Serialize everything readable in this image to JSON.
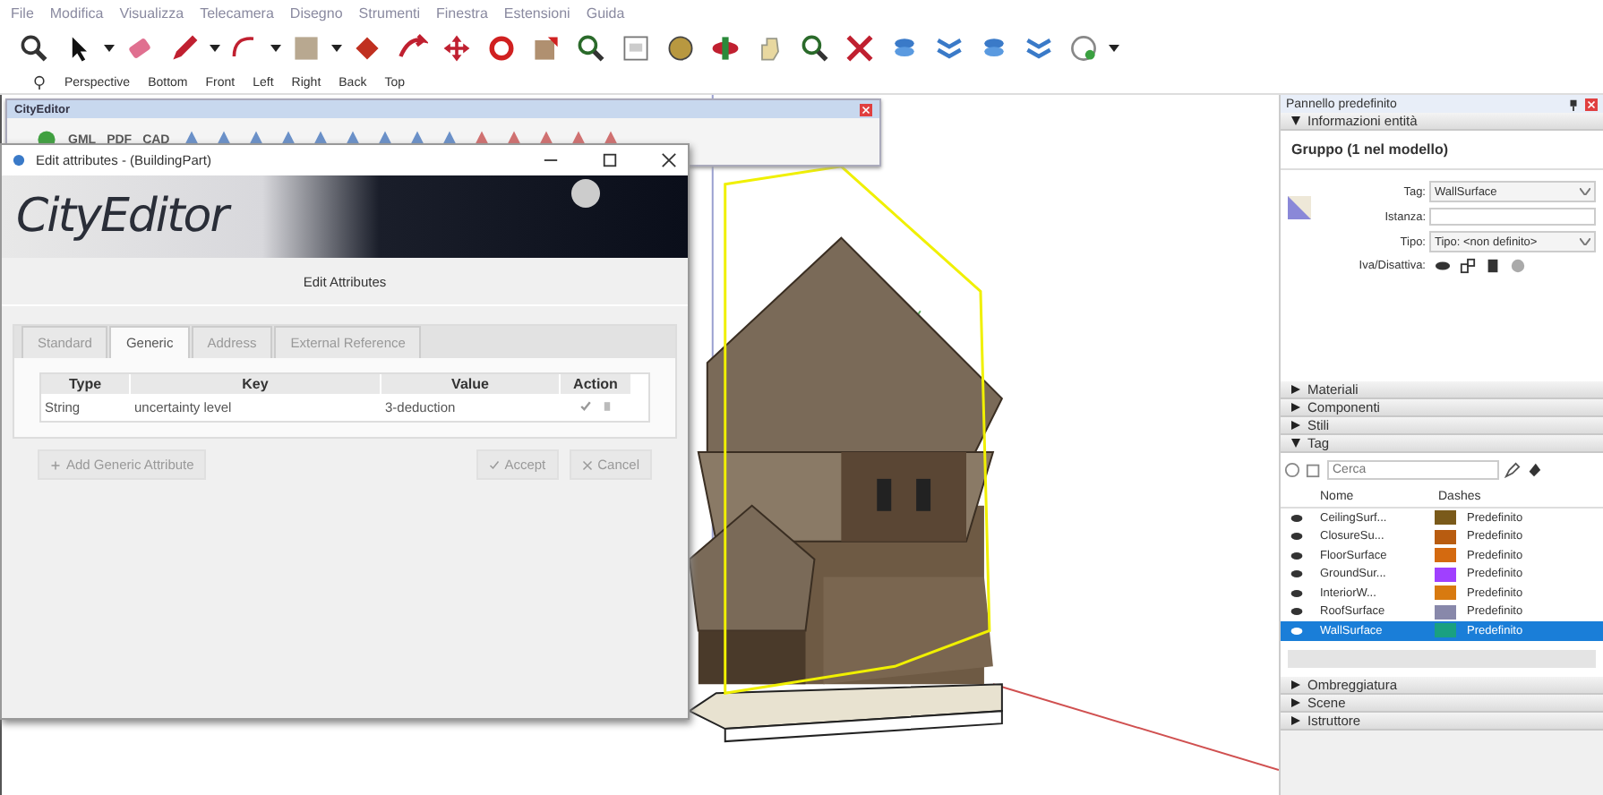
{
  "menu": [
    "File",
    "Modifica",
    "Visualizza",
    "Telecamera",
    "Disegno",
    "Strumenti",
    "Finestra",
    "Estensioni",
    "Guida"
  ],
  "views": [
    "Perspective",
    "Bottom",
    "Front",
    "Left",
    "Right",
    "Back",
    "Top"
  ],
  "cityeditor_toolbar": {
    "title": "CityEditor",
    "buttons": [
      "GML",
      "PDF",
      "CAD"
    ]
  },
  "dialog": {
    "title": "Edit attributes - (BuildingPart)",
    "logo": "CityEditor",
    "heading": "Edit Attributes",
    "tabs": [
      {
        "label": "Standard",
        "selected": false
      },
      {
        "label": "Generic",
        "selected": true
      },
      {
        "label": "Address",
        "selected": false
      },
      {
        "label": "External Reference",
        "selected": false
      }
    ],
    "table": {
      "columns": [
        "Type",
        "Key",
        "Value",
        "Action"
      ],
      "rows": [
        {
          "type": "String",
          "key": "uncertainty level",
          "value": "3-deduction"
        }
      ]
    },
    "add_button": "Add Generic Attribute",
    "accept_button": "Accept",
    "cancel_button": "Cancel"
  },
  "panel": {
    "title": "Pannello predefinito",
    "entity_info": {
      "header": "Informazioni entità",
      "expanded": true,
      "name": "Gruppo (1 nel modello)",
      "fields": [
        {
          "label": "Tag:",
          "kind": "dropdown",
          "value": "WallSurface"
        },
        {
          "label": "Istanza:",
          "kind": "input"
        },
        {
          "label": "Tipo:",
          "kind": "dropdown",
          "value": "Tipo: <non definito>"
        }
      ],
      "toggles_label": "Iva/Disattiva:"
    },
    "sections": [
      {
        "label": "Materiali",
        "expanded": false
      },
      {
        "label": "Componenti",
        "expanded": false
      },
      {
        "label": "Stili",
        "expanded": false
      },
      {
        "label": "Tag",
        "expanded": true
      }
    ],
    "tags": {
      "search_placeholder": "Cerca",
      "columns": [
        "Nome",
        "Dashes"
      ],
      "rows": [
        {
          "name": "CeilingSurf...",
          "color": "#7a5a1a",
          "dashes": "Predefinito",
          "selected": false
        },
        {
          "name": "ClosureSu...",
          "color": "#b85c10",
          "dashes": "Predefinito",
          "selected": false
        },
        {
          "name": "FloorSurface",
          "color": "#d46a10",
          "dashes": "Predefinito",
          "selected": false
        },
        {
          "name": "GroundSur...",
          "color": "#a040ff",
          "dashes": "Predefinito",
          "selected": false
        },
        {
          "name": "InteriorW...",
          "color": "#d87a10",
          "dashes": "Predefinito",
          "selected": false
        },
        {
          "name": "RoofSurface",
          "color": "#8888aa",
          "dashes": "Predefinito",
          "selected": false
        },
        {
          "name": "WallSurface",
          "color": "#1aa080",
          "dashes": "Predefinito",
          "selected": true
        }
      ]
    },
    "bottom_sections": [
      {
        "label": "Ombreggiatura",
        "expanded": false
      },
      {
        "label": "Scene",
        "expanded": false
      },
      {
        "label": "Istruttore",
        "expanded": false
      }
    ]
  }
}
